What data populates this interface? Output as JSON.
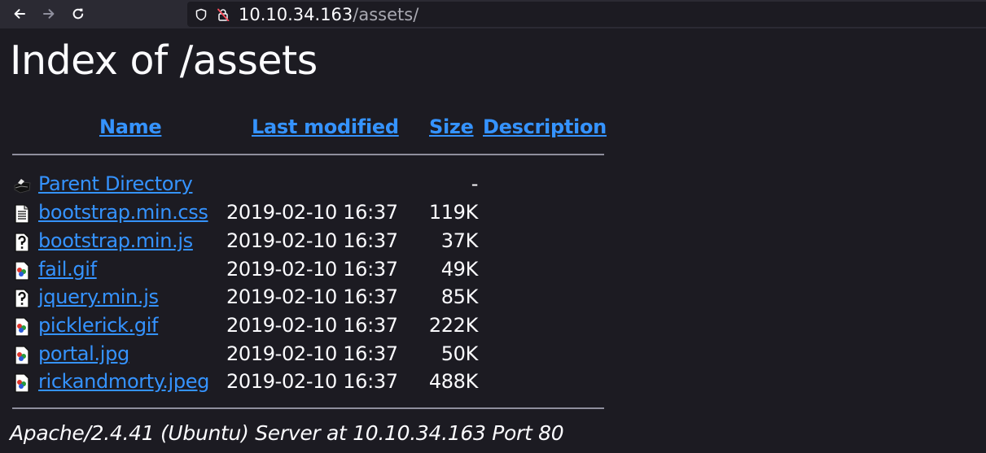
{
  "browser": {
    "url_host": "10.10.34.163",
    "url_path": "/assets/",
    "back_icon": "arrow-left-icon",
    "forward_icon": "arrow-right-icon",
    "reload_icon": "reload-icon",
    "tracking_icon": "shield-icon",
    "security_icon": "insecure-lock-icon"
  },
  "page": {
    "title": "Index of /assets",
    "headers": {
      "name": "Name",
      "last_modified": "Last modified",
      "size": "Size",
      "description": "Description"
    },
    "rows": [
      {
        "name": "Parent Directory",
        "modified": "",
        "size": "-",
        "icon": "back-folder-icon"
      },
      {
        "name": "bootstrap.min.css",
        "modified": "2019-02-10 16:37",
        "size": "119K",
        "icon": "text-file-icon"
      },
      {
        "name": "bootstrap.min.js",
        "modified": "2019-02-10 16:37",
        "size": "37K",
        "icon": "unknown-file-icon"
      },
      {
        "name": "fail.gif",
        "modified": "2019-02-10 16:37",
        "size": "49K",
        "icon": "image-file-icon"
      },
      {
        "name": "jquery.min.js",
        "modified": "2019-02-10 16:37",
        "size": "85K",
        "icon": "unknown-file-icon"
      },
      {
        "name": "picklerick.gif",
        "modified": "2019-02-10 16:37",
        "size": "222K",
        "icon": "image-file-icon"
      },
      {
        "name": "portal.jpg",
        "modified": "2019-02-10 16:37",
        "size": "50K",
        "icon": "image-file-icon"
      },
      {
        "name": "rickandmorty.jpeg",
        "modified": "2019-02-10 16:37",
        "size": "488K",
        "icon": "image-file-icon"
      }
    ],
    "address": "Apache/2.4.41 (Ubuntu) Server at 10.10.34.163 Port 80"
  },
  "colors": {
    "background": "#1c1b22",
    "toolbar": "#2b2a33",
    "link": "#3593ff",
    "text": "#fbfbfe"
  }
}
